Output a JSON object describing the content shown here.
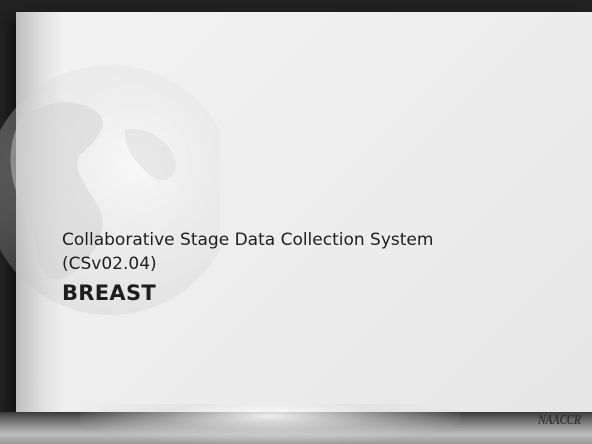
{
  "slide": {
    "subtitle_line1": "Collaborative Stage Data Collection System",
    "subtitle_line2": "(CSv02.04)",
    "title": "BREAST",
    "logo_text": "NAACCR"
  },
  "colors": {
    "panel_background": "#eeeeee",
    "text": "#1e1e1e",
    "frame": "#222222"
  },
  "icons": {
    "background_graphic": "globe-icon",
    "logo": "naaccr-logo-icon"
  }
}
